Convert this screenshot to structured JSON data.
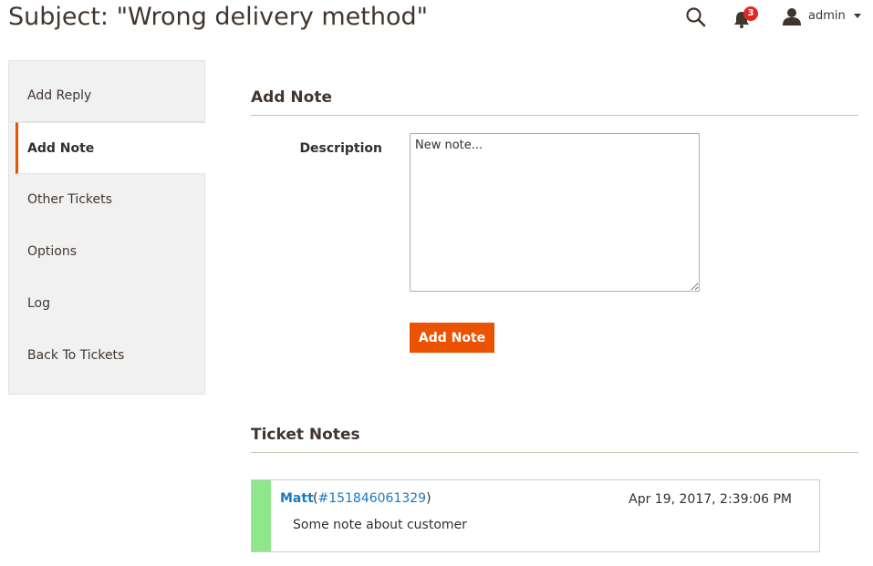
{
  "page": {
    "title": "Subject: \"Wrong delivery method\""
  },
  "header": {
    "search_icon": "search-icon",
    "notifications": {
      "icon": "bell-icon",
      "count": "3"
    },
    "user": {
      "icon": "user-icon",
      "name": "admin",
      "caret_icon": "caret-down-icon"
    }
  },
  "sidebar": {
    "items": [
      {
        "label": "Add Reply",
        "active": false
      },
      {
        "label": "Add Note",
        "active": true
      },
      {
        "label": "Other Tickets",
        "active": false
      },
      {
        "label": "Options",
        "active": false
      },
      {
        "label": "Log",
        "active": false
      },
      {
        "label": "Back To Tickets",
        "active": false
      }
    ]
  },
  "add_note": {
    "title": "Add Note",
    "description_label": "Description",
    "description_placeholder": "New note...",
    "submit_label": "Add Note"
  },
  "ticket_notes": {
    "title": "Ticket Notes",
    "notes": [
      {
        "author": "Matt",
        "open_paren": "(",
        "id": "#151846061329",
        "close_paren": ")",
        "date": "Apr 19, 2017, 2:39:06 PM",
        "text": "Some note about customer",
        "stripe_color": "#8fe68b"
      }
    ]
  },
  "colors": {
    "accent": "#eb5202",
    "link": "#1979c3",
    "badge": "#e22626"
  }
}
